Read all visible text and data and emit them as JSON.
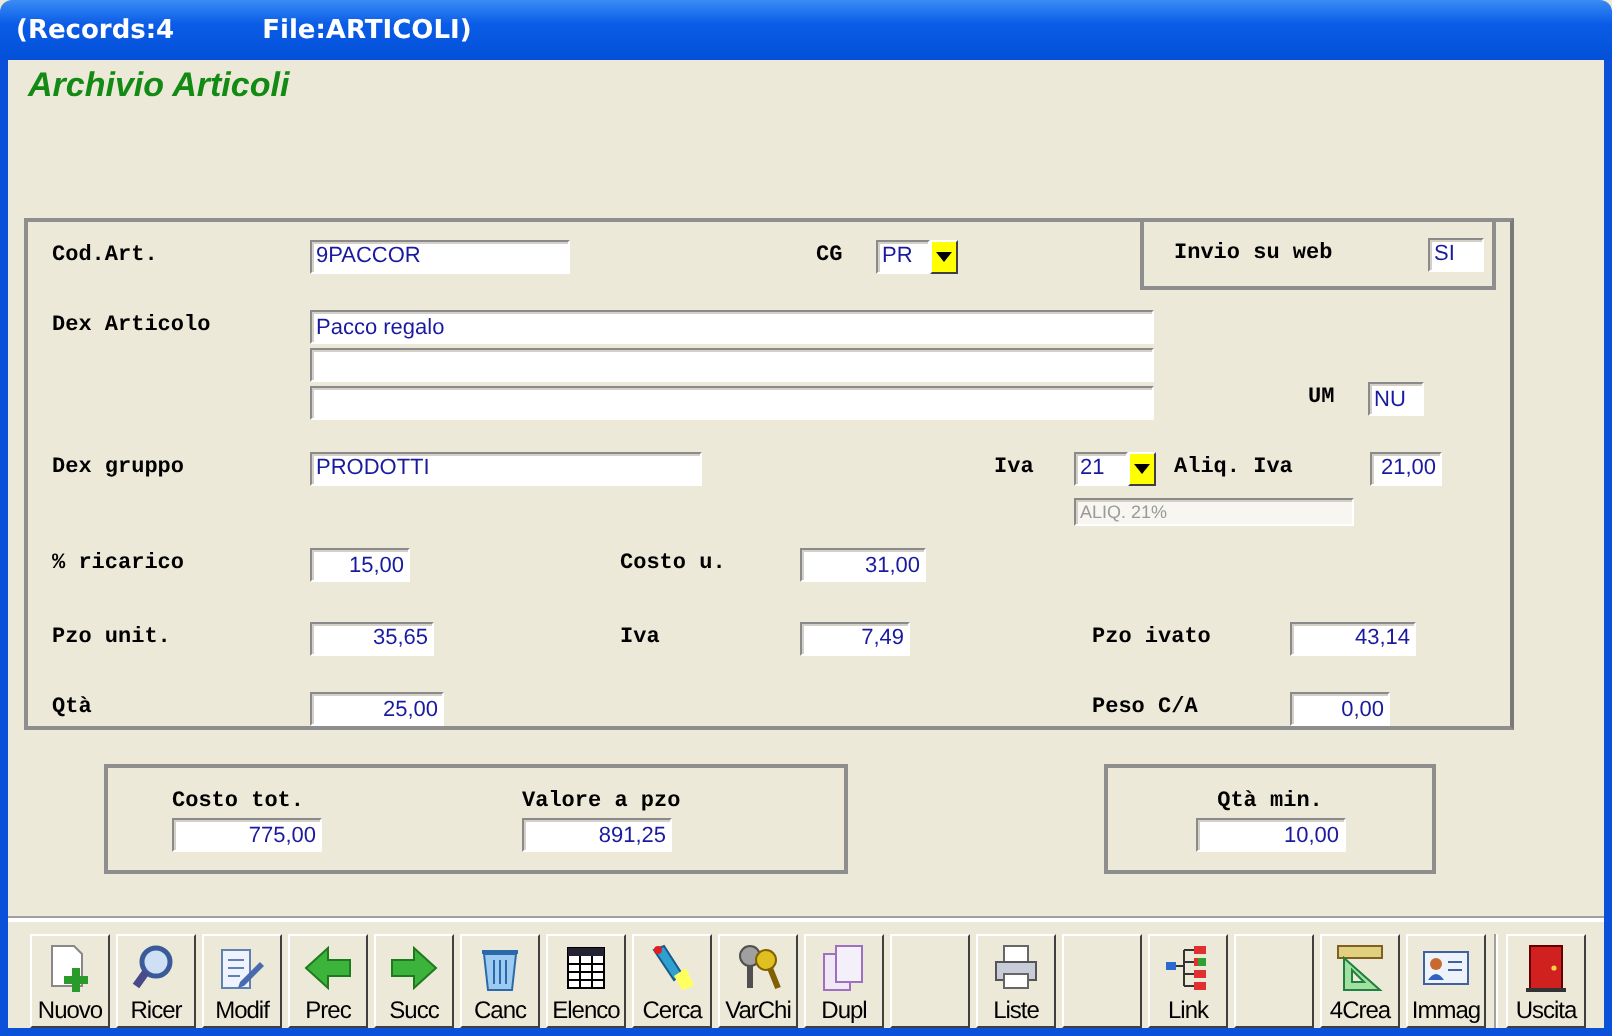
{
  "window": {
    "records": "(Records:4",
    "file": "File:ARTICOLI)"
  },
  "heading": "Archivio Articoli",
  "article": {
    "cod_art": {
      "label": "Cod.Art.",
      "value": "9PACCOR"
    },
    "cg": {
      "label": "CG",
      "value": "PR"
    },
    "invio_web": {
      "label": "Invio su web",
      "value": "SI"
    },
    "dex_articolo": {
      "label": "Dex Articolo",
      "lines": [
        "Pacco regalo"
      ]
    },
    "um": {
      "label": "UM",
      "value": "NU"
    },
    "dex_gruppo": {
      "label": "Dex gruppo",
      "value": "PRODOTTI"
    },
    "iva": {
      "label": "Iva",
      "value": "21"
    },
    "aliq_iva": {
      "label": "Aliq. Iva",
      "value": "21,00"
    },
    "aliq_desc": {
      "value": "ALIQ. 21%",
      "disabled": true
    },
    "ricarico": {
      "label": "% ricarico",
      "value": "15,00"
    },
    "costo_u": {
      "label": "Costo u.",
      "value": "31,00"
    },
    "pzo_unit": {
      "label": "Pzo unit.",
      "value": "35,65"
    },
    "iva_importo": {
      "label": "Iva",
      "value": "7,49"
    },
    "pzo_ivato": {
      "label": "Pzo ivato",
      "value": "43,14"
    },
    "qta": {
      "label": "Qtà",
      "value": "25,00"
    },
    "peso": {
      "label": "Peso C/A",
      "value": "0,00"
    }
  },
  "totals": {
    "costo_tot": {
      "label": "Costo tot.",
      "value": "775,00"
    },
    "valore_pzo": {
      "label": "Valore a pzo",
      "value": "891,25"
    },
    "qta_min": {
      "label": "Qtà min.",
      "value": "10,00"
    }
  },
  "toolbar": [
    {
      "kind": "button",
      "label": "Nuovo"
    },
    {
      "kind": "button",
      "label": "Ricer"
    },
    {
      "kind": "button",
      "label": "Modif"
    },
    {
      "kind": "button",
      "label": "Prec"
    },
    {
      "kind": "button",
      "label": "Succ"
    },
    {
      "kind": "button",
      "label": "Canc"
    },
    {
      "kind": "button",
      "label": "Elenco"
    },
    {
      "kind": "button",
      "label": "Cerca"
    },
    {
      "kind": "button",
      "label": "VarChi"
    },
    {
      "kind": "button",
      "label": "Dupl"
    },
    {
      "kind": "empty"
    },
    {
      "kind": "button",
      "label": "Liste"
    },
    {
      "kind": "empty"
    },
    {
      "kind": "button",
      "label": "Link"
    },
    {
      "kind": "empty"
    },
    {
      "kind": "button",
      "label": "4Crea"
    },
    {
      "kind": "button",
      "label": "Immag"
    },
    {
      "kind": "exit",
      "label": "Uscita"
    }
  ]
}
